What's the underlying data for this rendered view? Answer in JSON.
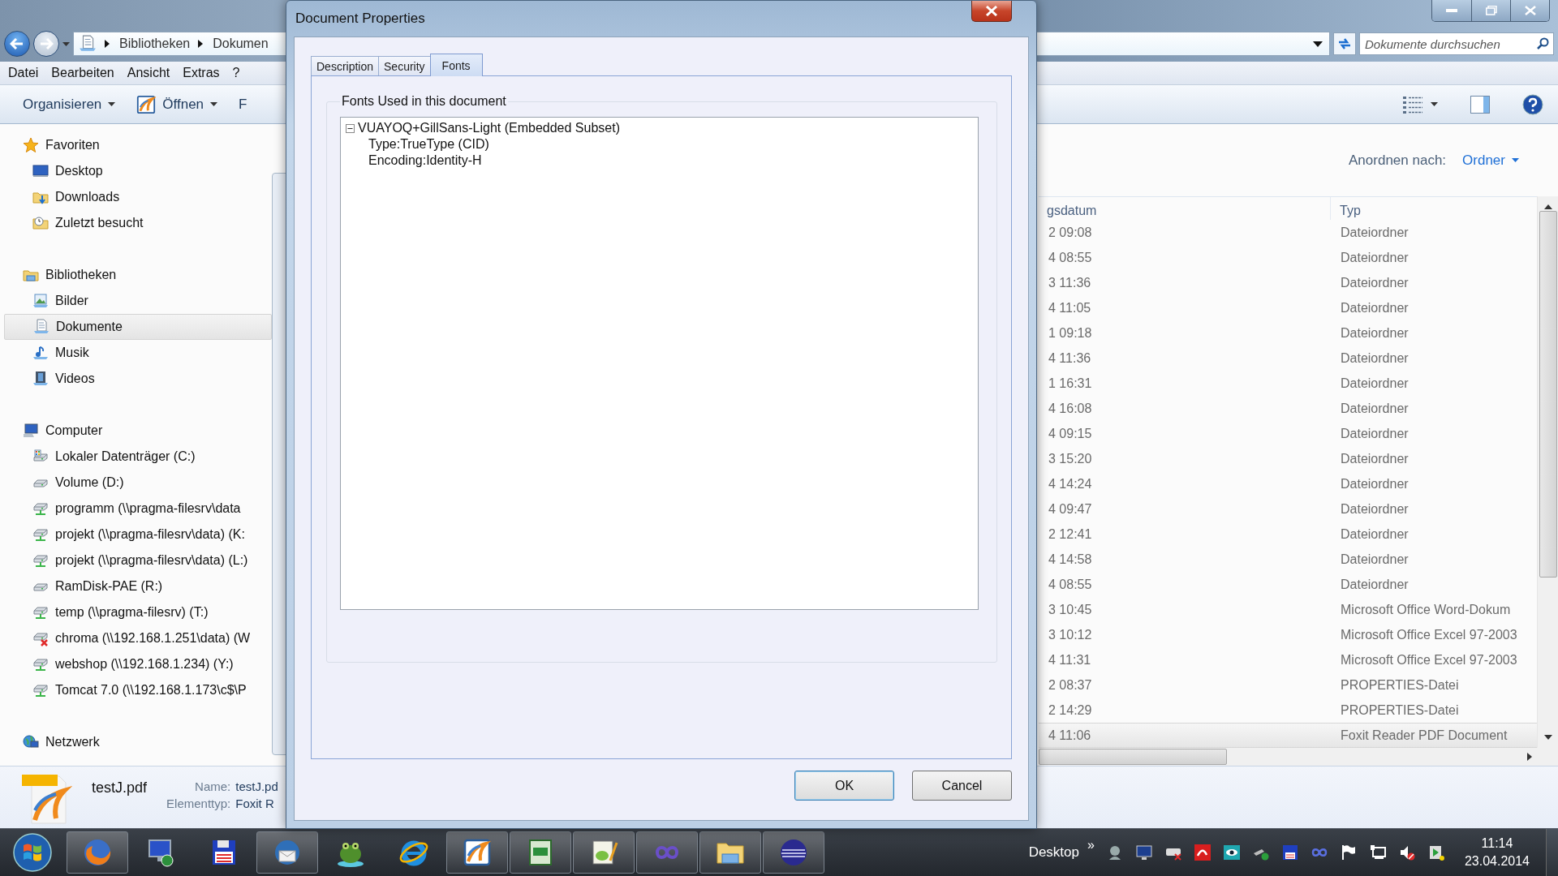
{
  "address": {
    "breadcrumb": [
      "Bibliotheken",
      "Dokumen"
    ],
    "search": {
      "placeholder": "Dokumente durchsuchen"
    }
  },
  "menu": [
    "Datei",
    "Bearbeiten",
    "Ansicht",
    "Extras",
    "?"
  ],
  "toolbar": [
    {
      "label": "Organisieren",
      "kind": "dropdown"
    },
    {
      "label": "Öffnen",
      "kind": "app-dropdown"
    },
    {
      "label": "F",
      "kind": "plain"
    }
  ],
  "sidebar": {
    "groups": [
      {
        "label": "Favoriten",
        "kind": "star",
        "selected": false,
        "children": [
          {
            "label": "Desktop",
            "kind": "desktop",
            "selected": false
          },
          {
            "label": "Downloads",
            "kind": "downloads",
            "selected": false
          },
          {
            "label": "Zuletzt besucht",
            "kind": "recent",
            "selected": false
          }
        ]
      },
      {
        "label": "Bibliotheken",
        "kind": "library",
        "selected": false,
        "children": [
          {
            "label": "Bilder",
            "kind": "pictures",
            "selected": false
          },
          {
            "label": "Dokumente",
            "kind": "documents",
            "selected": true
          },
          {
            "label": "Musik",
            "kind": "music",
            "selected": false
          },
          {
            "label": "Videos",
            "kind": "videos",
            "selected": false
          }
        ]
      },
      {
        "label": "Computer",
        "kind": "computer",
        "selected": false,
        "children": [
          {
            "label": "Lokaler Datenträger (C:)",
            "kind": "drive-c",
            "selected": false
          },
          {
            "label": "Volume (D:)",
            "kind": "drive",
            "selected": false
          },
          {
            "label": "programm (\\\\pragma-filesrv\\data",
            "kind": "net-drive",
            "selected": false
          },
          {
            "label": "projekt (\\\\pragma-filesrv\\data) (K:",
            "kind": "net-drive",
            "selected": false
          },
          {
            "label": "projekt (\\\\pragma-filesrv\\data) (L:)",
            "kind": "net-drive",
            "selected": false
          },
          {
            "label": "RamDisk-PAE (R:)",
            "kind": "drive",
            "selected": false
          },
          {
            "label": "temp (\\\\pragma-filesrv) (T:)",
            "kind": "net-drive",
            "selected": false
          },
          {
            "label": "chroma (\\\\192.168.1.251\\data) (W",
            "kind": "net-drive-error",
            "selected": false
          },
          {
            "label": "webshop (\\\\192.168.1.234) (Y:)",
            "kind": "net-drive",
            "selected": false
          },
          {
            "label": "Tomcat 7.0 (\\\\192.168.1.173\\c$\\P",
            "kind": "net-drive",
            "selected": false
          }
        ]
      },
      {
        "label": "Netzwerk",
        "kind": "network",
        "selected": false
      }
    ]
  },
  "file_list": {
    "arrange": {
      "label": "Anordnen nach:",
      "value": "Ordner"
    },
    "columns": [
      "gsdatum",
      "Typ"
    ],
    "rows": [
      {
        "date": "2 09:08",
        "type": "Dateiordner",
        "selected": false
      },
      {
        "date": "4 08:55",
        "type": "Dateiordner",
        "selected": false
      },
      {
        "date": "3 11:36",
        "type": "Dateiordner",
        "selected": false
      },
      {
        "date": "4 11:05",
        "type": "Dateiordner",
        "selected": false
      },
      {
        "date": "1 09:18",
        "type": "Dateiordner",
        "selected": false
      },
      {
        "date": "4 11:36",
        "type": "Dateiordner",
        "selected": false
      },
      {
        "date": "1 16:31",
        "type": "Dateiordner",
        "selected": false
      },
      {
        "date": "4 16:08",
        "type": "Dateiordner",
        "selected": false
      },
      {
        "date": "4 09:15",
        "type": "Dateiordner",
        "selected": false
      },
      {
        "date": "3 15:20",
        "type": "Dateiordner",
        "selected": false
      },
      {
        "date": "4 14:24",
        "type": "Dateiordner",
        "selected": false
      },
      {
        "date": "4 09:47",
        "type": "Dateiordner",
        "selected": false
      },
      {
        "date": "2 12:41",
        "type": "Dateiordner",
        "selected": false
      },
      {
        "date": "4 14:58",
        "type": "Dateiordner",
        "selected": false
      },
      {
        "date": "4 08:55",
        "type": "Dateiordner",
        "selected": false
      },
      {
        "date": "3 10:45",
        "type": "Microsoft Office Word-Dokum",
        "selected": false
      },
      {
        "date": "3 10:12",
        "type": "Microsoft Office Excel 97-2003",
        "selected": false
      },
      {
        "date": "4 11:31",
        "type": "Microsoft Office Excel 97-2003",
        "selected": false
      },
      {
        "date": "2 08:37",
        "type": "PROPERTIES-Datei",
        "selected": false
      },
      {
        "date": "2 14:29",
        "type": "PROPERTIES-Datei",
        "selected": false
      },
      {
        "date": "4 11:06",
        "type": "Foxit Reader PDF Document",
        "selected": true
      }
    ]
  },
  "details": {
    "file_name": "testJ.pdf",
    "fields": [
      {
        "label": "Name:",
        "value": "testJ.pd"
      },
      {
        "label": "Elementtyp:",
        "value": "Foxit R"
      }
    ]
  },
  "dialog": {
    "title": "Document Properties",
    "tabs": [
      {
        "label": "Description",
        "selected": false
      },
      {
        "label": "Security",
        "selected": false
      },
      {
        "label": "Fonts",
        "selected": true
      }
    ],
    "group_label": "Fonts Used in this document",
    "fonts": [
      {
        "name": "VUAYOQ+GillSans-Light (Embedded Subset)",
        "expanded": true,
        "children": [
          {
            "name": "Type:TrueType (CID)"
          },
          {
            "name": "Encoding:Identity-H"
          }
        ]
      }
    ],
    "buttons": [
      {
        "label": "OK",
        "default": true
      },
      {
        "label": "Cancel",
        "default": false
      }
    ]
  },
  "taskbar": {
    "apps": [
      {
        "kind": "firefox",
        "running": true
      },
      {
        "kind": "remote",
        "running": false
      },
      {
        "kind": "floppy",
        "running": false
      },
      {
        "kind": "mail",
        "running": true
      },
      {
        "kind": "frog",
        "running": false
      },
      {
        "kind": "ie",
        "running": false
      },
      {
        "kind": "pdf",
        "running": true
      },
      {
        "kind": "tile",
        "running": true
      },
      {
        "kind": "notepad",
        "running": true
      },
      {
        "kind": "infinity",
        "running": true
      },
      {
        "kind": "folder",
        "running": true
      },
      {
        "kind": "sphere",
        "running": true
      }
    ],
    "toolbar_label": "Desktop",
    "overflow": "»",
    "tray": [
      {
        "kind": "person"
      },
      {
        "kind": "monitor"
      },
      {
        "kind": "drive-error"
      },
      {
        "kind": "swoosh"
      },
      {
        "kind": "eye"
      },
      {
        "kind": "usb"
      },
      {
        "kind": "floppy"
      },
      {
        "kind": "infinity"
      },
      {
        "kind": "flag"
      },
      {
        "kind": "network"
      },
      {
        "kind": "speaker-muted"
      },
      {
        "kind": "play"
      }
    ],
    "time": "11:14",
    "date": "23.04.2014"
  }
}
